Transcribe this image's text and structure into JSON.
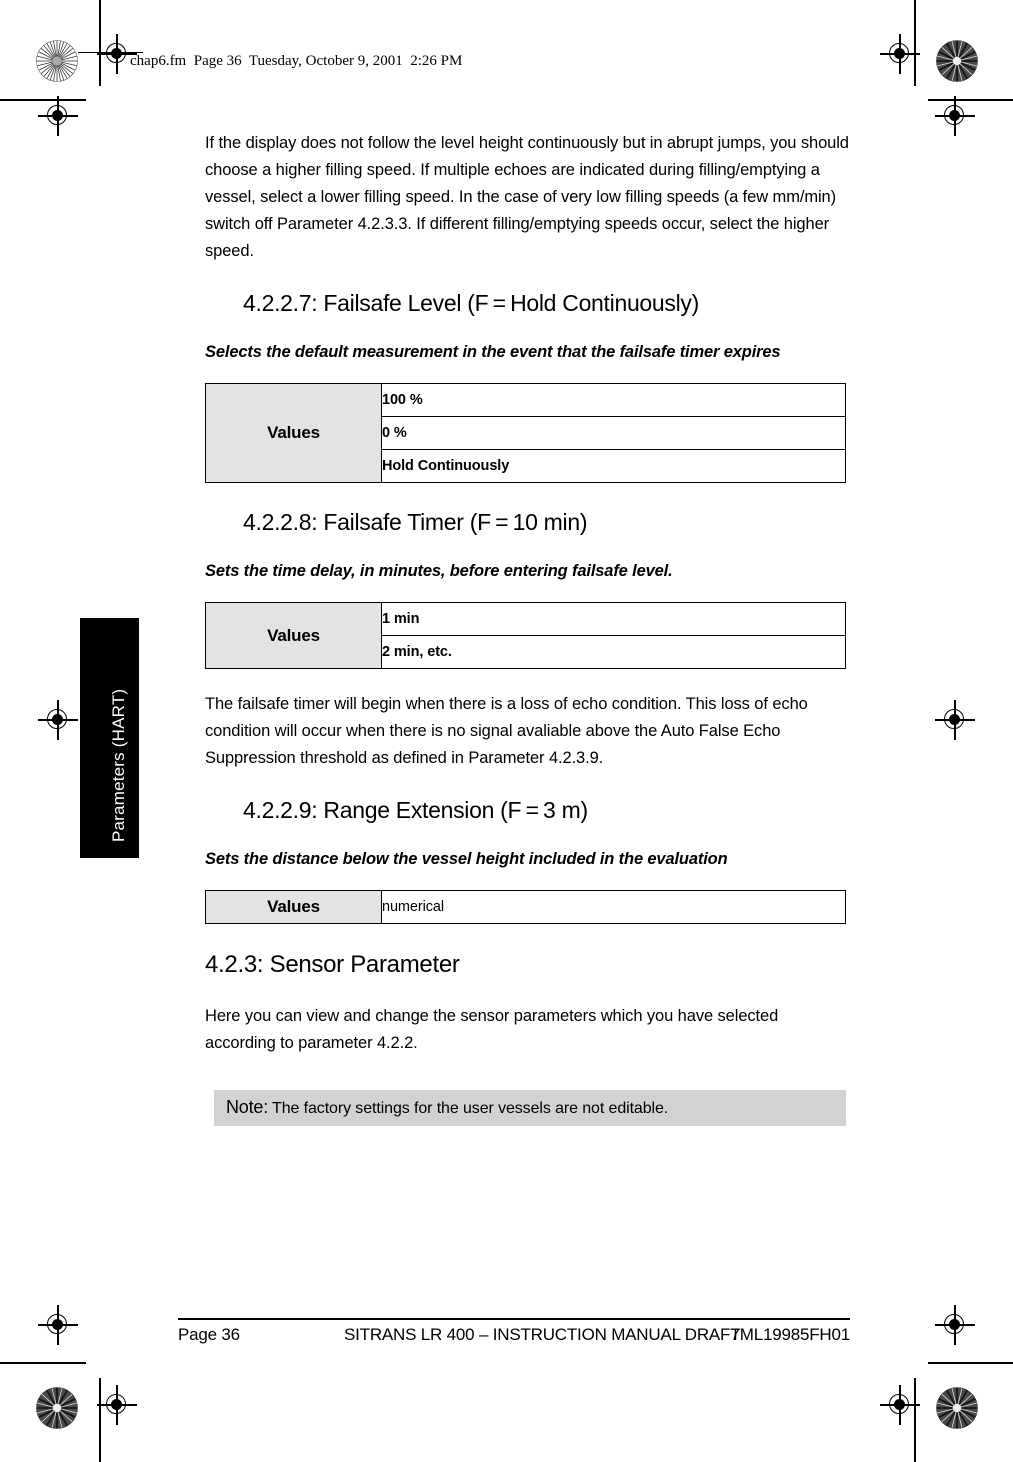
{
  "filemark": {
    "text": "chap6.fm  Page 36  Tuesday, October 9, 2001  2:26 PM"
  },
  "side_tab": {
    "label": "Parameters (HART)",
    "background": "#000000",
    "text_color": "#ffffff"
  },
  "content": {
    "intro_paragraph": "If the display does not follow the level height continuously but in abrupt jumps, you should choose a higher filling speed. If multiple echoes are indicated during filling/emptying a vessel, select a lower filling speed. In the case of very low filling speeds (a few mm/min) switch off Parameter 4.2.3.3. If different filling/emptying speeds occur, select the higher speed.",
    "sections": [
      {
        "heading": "4.2.2.7: Failsafe Level (F = Hold Continuously)",
        "subtitle": "Selects the default measurement in the event that the failsafe timer expires",
        "table": {
          "label": "Values",
          "rows": [
            "100 %",
            "0 %",
            "Hold Continuously"
          ]
        }
      },
      {
        "heading": "4.2.2.8: Failsafe Timer (F = 10 min)",
        "subtitle": "Sets the time delay, in minutes, before entering failsafe level.",
        "table": {
          "label": "Values",
          "rows": [
            "1 min",
            "2 min, etc."
          ]
        }
      },
      {
        "heading": "4.2.2.9: Range Extension (F = 3 m)",
        "subtitle": "Sets the distance below the vessel height included in the evaluation",
        "table": {
          "label": "Values",
          "rows": [
            "numerical"
          ]
        }
      }
    ],
    "failsafe_timer_note_paragraph": "The failsafe timer will begin when there is a loss of echo condition. This loss of echo condition will occur when there is no signal avaliable above the Auto False Echo Suppression threshold as defined in Parameter 4.2.3.9.",
    "sensor_section": {
      "heading": "4.2.3: Sensor Parameter",
      "paragraph": "Here you can view and change the sensor parameters which you have selected according to parameter 4.2.2."
    },
    "note_box": {
      "word": "Note:",
      "text": "The factory settings for the user vessels are not editable.",
      "background": "#d2d2d2"
    }
  },
  "footer": {
    "page": "Page 36",
    "title": "SITRANS LR 400 – INSTRUCTION MANUAL DRAFT",
    "code": "7ML19985FH01"
  }
}
